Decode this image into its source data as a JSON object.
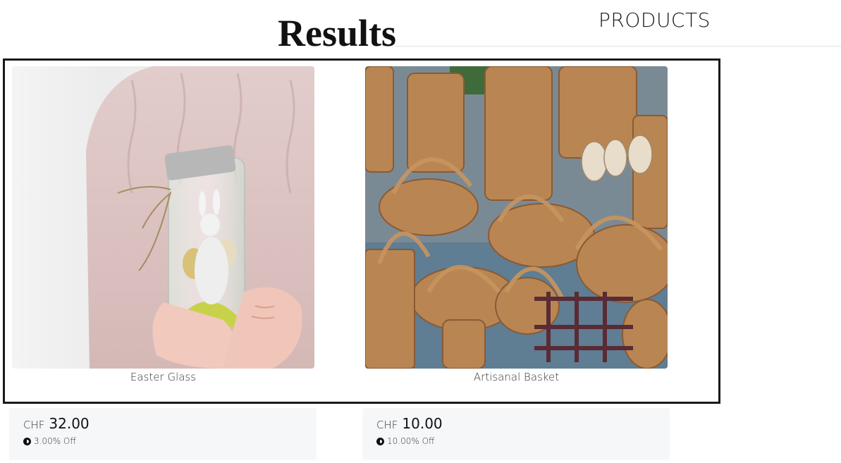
{
  "header": {
    "products_label": "PRODUCTS",
    "results_title": "Results"
  },
  "products": [
    {
      "name": "Easter Glass",
      "image": "easter-glass-jar-bunny-photo",
      "currency": "CHF",
      "price": "32.00",
      "discount": "3.00% Off",
      "discount_icon": "percent-badge-icon"
    },
    {
      "name": "Artisanal Basket",
      "image": "wicker-baskets-photo",
      "currency": "CHF",
      "price": "10.00",
      "discount": "10.00% Off",
      "discount_icon": "percent-badge-icon"
    }
  ],
  "colors": {
    "box_border": "#1a1a1a",
    "card_background": "#f6f7f9"
  }
}
